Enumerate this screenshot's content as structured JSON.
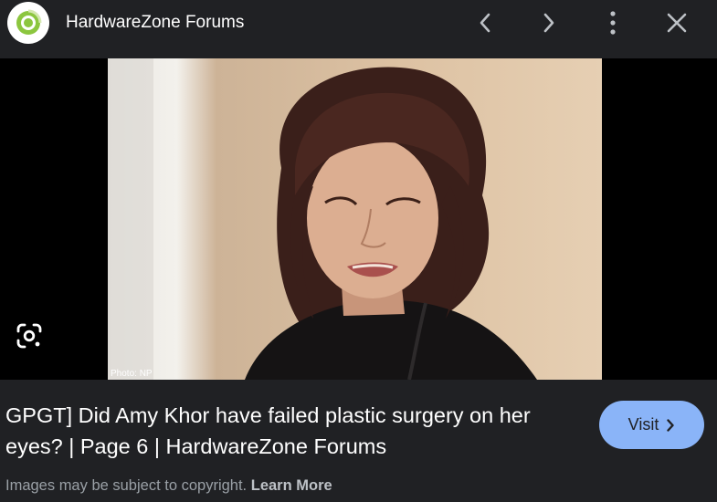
{
  "header": {
    "site_name": "HardwareZone Forums",
    "logo_icon": "hardwarezone-logo",
    "prev_icon": "chevron-left-icon",
    "next_icon": "chevron-right-icon",
    "more_icon": "more-vert-icon",
    "close_icon": "close-icon"
  },
  "image": {
    "credit": "Photo: NP"
  },
  "lens": {
    "icon": "google-lens-icon"
  },
  "result": {
    "title": "GPGT] Did Amy Khor have failed plastic surgery on her eyes? | Page 6 | HardwareZone Forums",
    "visit_label": "Visit",
    "copyright_text": "Images may be subject to copyright.",
    "learn_more": "Learn More"
  },
  "colors": {
    "background": "#202124",
    "visit_button": "#8ab4f8",
    "logo_accent": "#8cc63f"
  }
}
